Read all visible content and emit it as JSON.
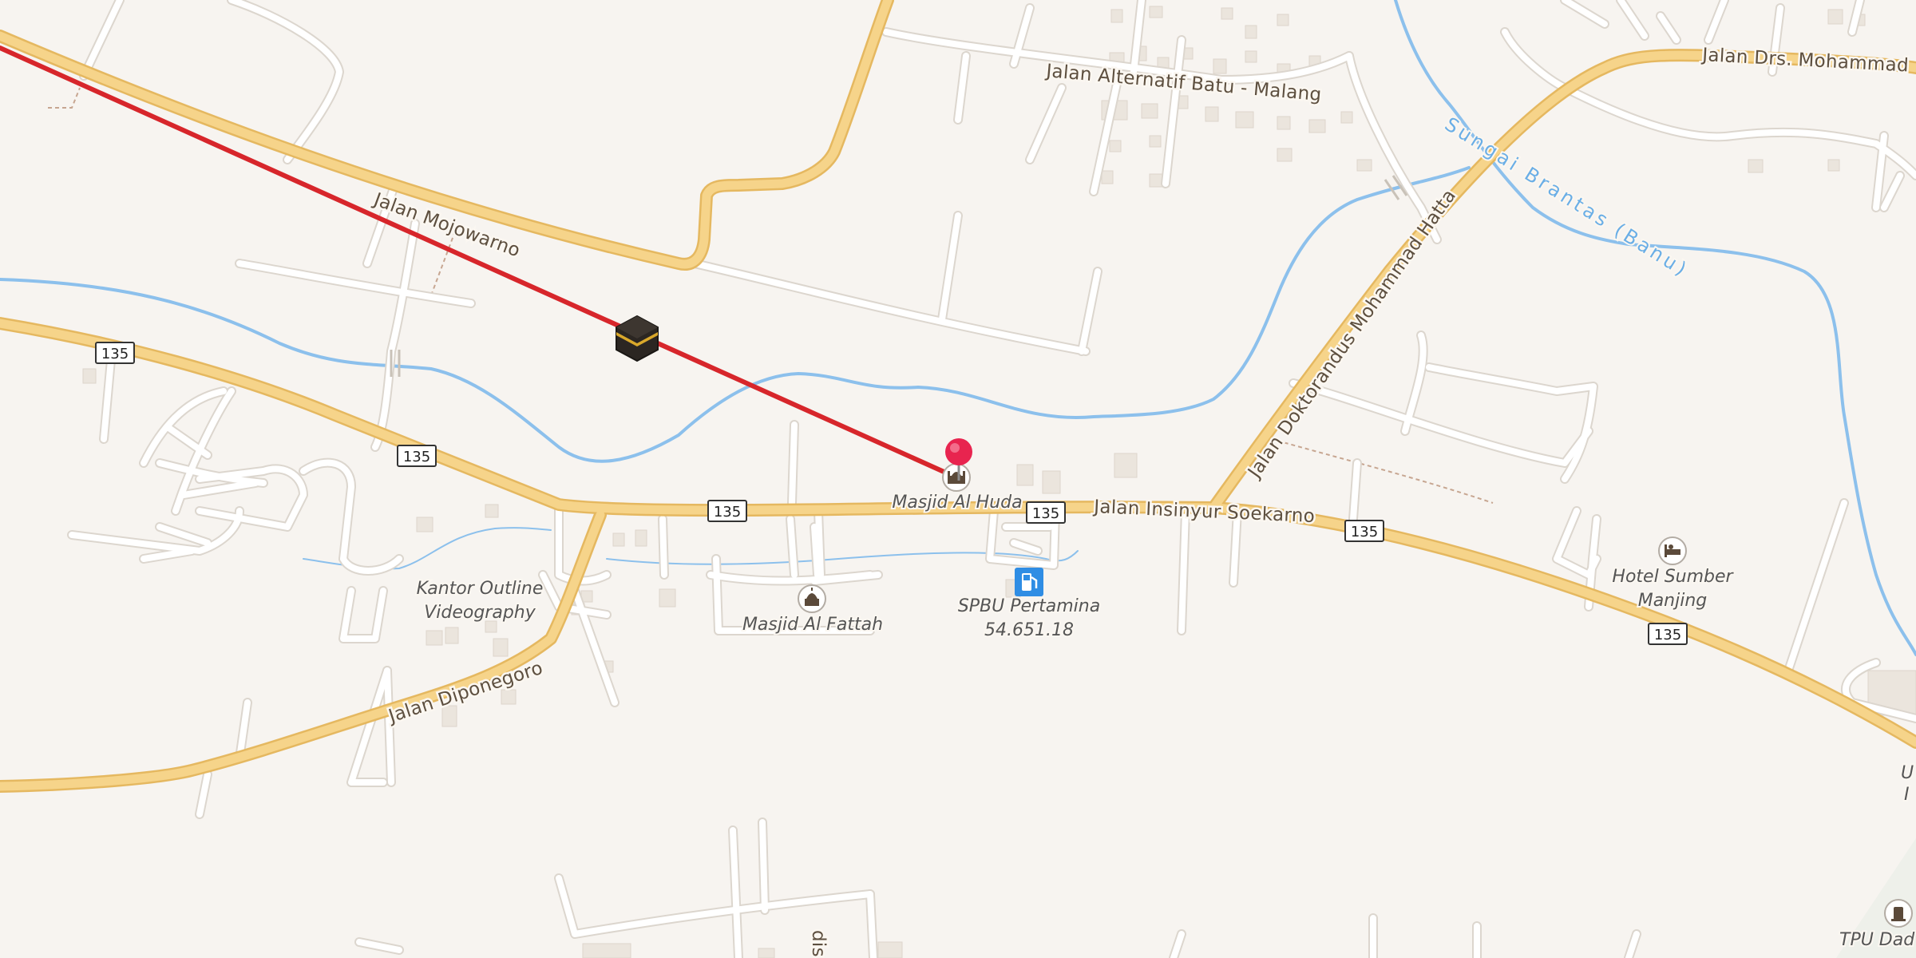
{
  "colors": {
    "land": "#f7f4f0",
    "major_road": "#f6d48a",
    "major_road_casing": "#e5b860",
    "minor_road": "#ffffff",
    "minor_road_casing": "#dcd6ce",
    "water": "#8cc0ec",
    "qibla_line": "#d7262b",
    "pin": "#e8244f",
    "fuel": "#2f8de4",
    "building": "#ebe5dd"
  },
  "roads": {
    "mojowarno": "Jalan Mojowarno",
    "alternatif": "Jalan Alternatif Batu - Malang",
    "drs_hatta": "Jalan Drs. Mohammad",
    "doktorandus": "Jalan Doktorandus Mohammad Hatta",
    "soekarno": "Jalan Insinyur Soekarno",
    "diponegoro": "Jalan Diponegoro",
    "dis": "dis"
  },
  "water": {
    "river": "Sungai Brantas (Banu)"
  },
  "shields": [
    "135",
    "135",
    "135",
    "135",
    "135",
    "135"
  ],
  "pois": {
    "masjid_al_huda": "Masjid Al Huda",
    "kantor_line1": "Kantor Outline",
    "kantor_line2": "Videography",
    "masjid_al_fattah": "Masjid Al Fattah",
    "spbu_line1": "SPBU Pertamina",
    "spbu_line2": "54.651.18",
    "hotel_line1": "Hotel Sumber",
    "hotel_line2": "Manjing",
    "tpu": "TPU Dad",
    "edge_u": "U",
    "edge_i": "I"
  },
  "icons": {
    "kaaba": "kaaba-icon",
    "location_pin": "location-pin-icon",
    "mosque": "mosque-icon",
    "fuel": "fuel-station-icon",
    "hotel": "bed-icon",
    "cemetery": "grave-icon"
  }
}
